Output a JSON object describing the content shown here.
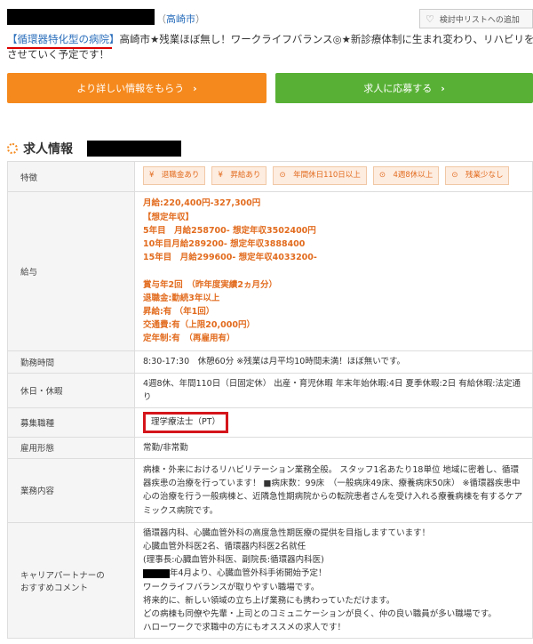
{
  "header": {
    "location": "高崎市",
    "favorite_label": "検討中リストへの追加"
  },
  "lead": {
    "badge": "【循環器特化型の病院】",
    "text1": "高崎市★残業ほぼ無し！ワークライフバランス◎★新診療体制に生まれ変わり、リハビリを充実",
    "text2": "させていく予定です！"
  },
  "buttons": {
    "info": "より詳しい情報をもらう",
    "apply": "求人に応募する"
  },
  "section_title": "求人情報",
  "rows": {
    "features": {
      "label": "特徴",
      "tags": [
        "退職金あり",
        "昇給あり",
        "年間休日110日以上",
        "4週8休以上",
        "残業少なし"
      ]
    },
    "salary": {
      "label": "給与",
      "lines": [
        "月給:220,400円-327,300円",
        "【想定年収】",
        "5年目　月給258700- 想定年収3502400円",
        "10年目月給289200- 想定年収3888400",
        "15年目　月給299600- 想定年収4033200-",
        "",
        "賞与年2回　（昨年度実績2ヵ月分）",
        "退職金:勤続3年以上",
        "昇給:有 （年1回）",
        "交通費:有（上限20,000円）",
        "定年制:有　（再雇用有）"
      ]
    },
    "hours": {
      "label": "勤務時間",
      "value": "8:30-17:30　休憩60分 ※残業は月平均10時間未満！ほぼ無いです。"
    },
    "holidays": {
      "label": "休日・休暇",
      "value": "4週8休、年間110日（日固定休）  出産・育児休暇 年末年始休暇:4日 夏季休暇:2日 有給休暇:法定通り"
    },
    "job_type": {
      "label": "募集職種",
      "value": "理学療法士（PT）"
    },
    "employment": {
      "label": "雇用形態",
      "value": "常勤/非常勤"
    },
    "duties": {
      "label": "業務内容",
      "value": "病棟・外来におけるリハビリテーション業務全般。 スタッフ1名あたり18単位 地域に密着し、循環器疾患の治療を行っています！ ■病床数：99床　（一般病床49床、療養病床50床） ※循環器疾患中心の治療を行う一般病棟と、近隣急性期病院からの転院患者さんを受け入れる療養病棟を有するケアミックス病院です。"
    },
    "comment": {
      "label1": "キャリアパートナーの",
      "label2": "おすすめコメント",
      "lines": [
        "循環器内科、心臓血管外科の高度急性期医療の提供を目指しますています！",
        "心臓血管外科医2名、循環器内科医2名就任",
        "(理事長:心臓血管外科医、副院長:循環器内科医)",
        "年4月より、心臓血管外科手術開始予定！",
        "ワークライフバランスが取りやすい職場です。",
        "将来的に、新しい領域の立ち上げ業務にも携わっていただけます。",
        "どの病棟も同僚や先輩・上司とのコミュニケーションが良く、仲の良い職員が多い職場です。",
        "ハローワークで求職中の方にもオススメの求人です！"
      ]
    }
  }
}
